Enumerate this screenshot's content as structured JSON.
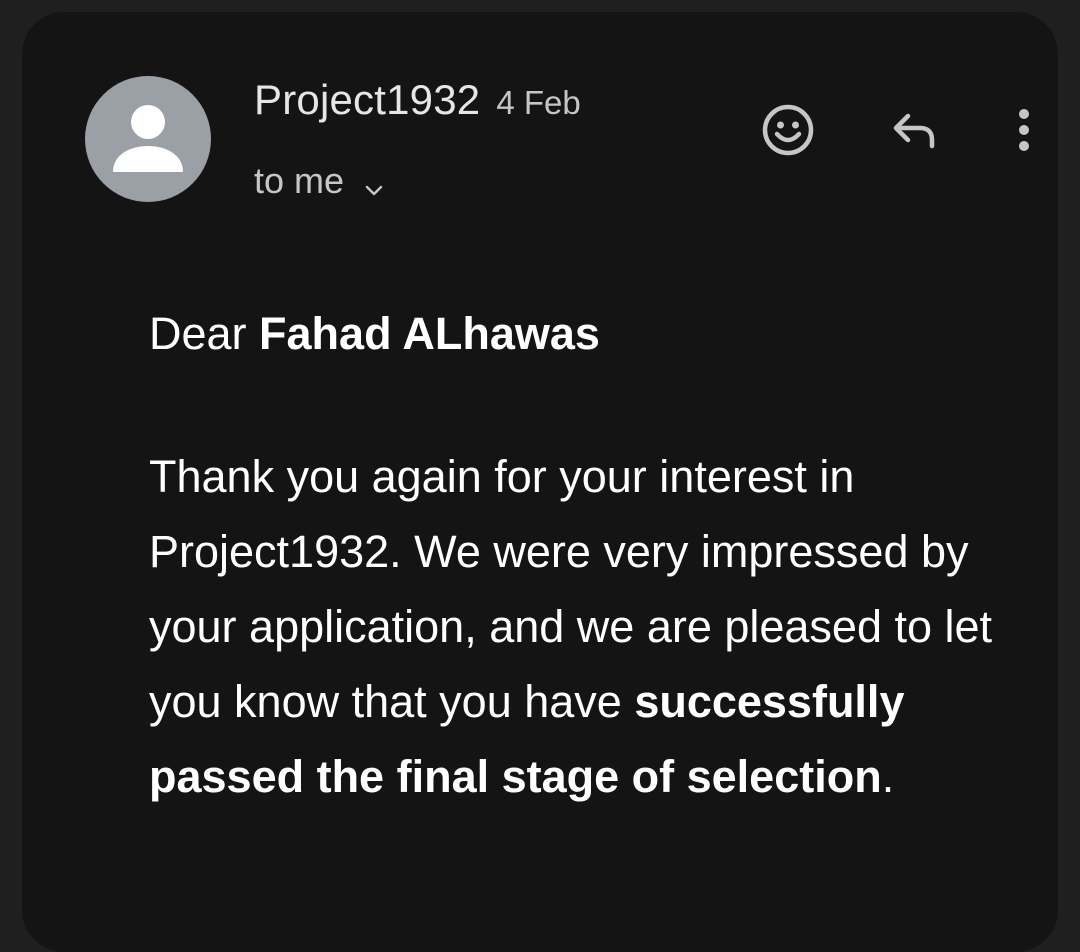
{
  "email": {
    "sender": {
      "name": "Project1932",
      "date": "4 Feb",
      "recipient_label": "to me"
    },
    "actions": {
      "emoji_icon": "emoji-react-icon",
      "reply_icon": "reply-icon",
      "more_icon": "more-vert-icon"
    },
    "body": {
      "greeting_prefix": "Dear ",
      "recipient_name": "Fahad ALhawas",
      "paragraph_start": "Thank you again for your interest in Project1932. We were very impressed by your application, and we are pleased to let you know that you have ",
      "paragraph_bold": "successfully passed the final stage of selection",
      "paragraph_end": "."
    }
  },
  "colors": {
    "page_background": "#1f1f1f",
    "card_background": "#141414",
    "avatar_background": "#9aa0a6",
    "primary_text": "#ffffff",
    "secondary_text": "#c4c7c5"
  }
}
